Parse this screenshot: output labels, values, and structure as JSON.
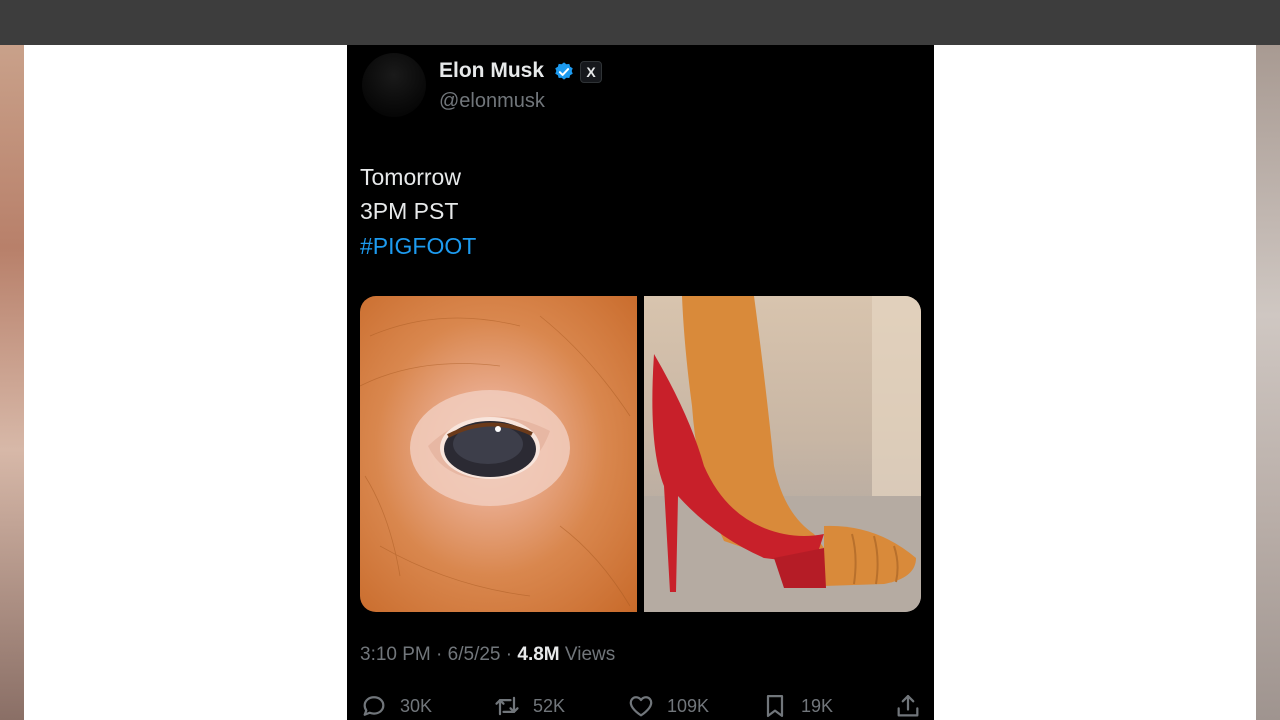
{
  "tweet": {
    "author_name": "Elon Musk",
    "author_handle": "@elonmusk",
    "x_badge": "X",
    "text_lines": [
      "Tomorrow",
      "3PM PST",
      "#PIGFOOT"
    ],
    "time": "3:10 PM",
    "date": "6/5/25",
    "views_count": "4.8M",
    "views_label": "Views",
    "replies": "30K",
    "reposts": "52K",
    "likes": "109K",
    "bookmarks": "19K",
    "accent_color": "#1d9bf0",
    "icons": {
      "verified": "verified-badge-icon",
      "reply": "reply-icon",
      "repost": "repost-icon",
      "like": "heart-icon",
      "bookmark": "bookmark-icon",
      "share": "share-icon"
    }
  }
}
